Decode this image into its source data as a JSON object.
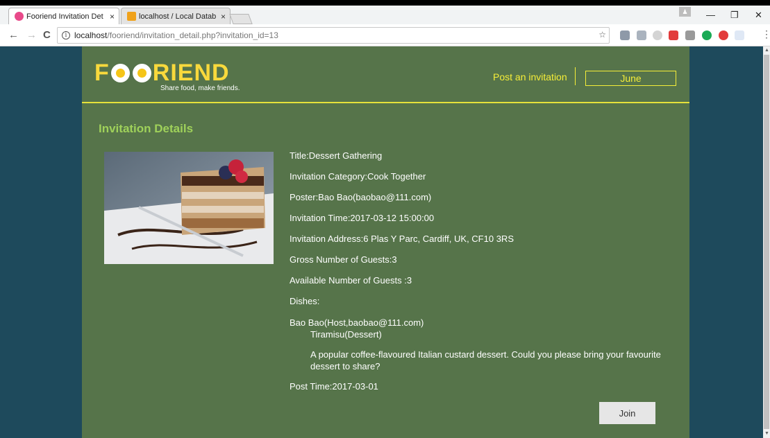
{
  "browser": {
    "tabs": [
      {
        "title": "Fooriend Invitation Det",
        "close": "×"
      },
      {
        "title": "localhost / Local Datab",
        "close": "×"
      }
    ],
    "url_host": "localhost",
    "url_path": "/fooriend/invitation_detail.php?invitation_id=13",
    "nav": {
      "back": "←",
      "forward": "→",
      "reload": "C"
    },
    "window": {
      "minimize": "—",
      "restore": "❐",
      "close": "✕"
    }
  },
  "site": {
    "logo_left": "F",
    "logo_right": "RIEND",
    "tagline": "Share food, make friends.",
    "post_invitation": "Post an invitation",
    "user_name": "June"
  },
  "section_title": "Invitation Details",
  "invitation": {
    "title": "Title:Dessert Gathering",
    "category": "Invitation Category:Cook Together",
    "poster": "Poster:Bao Bao(baobao@111.com)",
    "time": "Invitation Time:2017-03-12 15:00:00",
    "address": "Invitation Address:6 Plas Y Parc, Cardiff, UK, CF10 3RS",
    "gross_guests": "Gross Number of Guests:3",
    "available_guests": "Available Number of Guests :3",
    "dishes_label": "Dishes:",
    "dish_host": "Bao Bao(Host,baobao@111.com)",
    "dish_name": "Tiramisu(Dessert)",
    "dish_description": "A popular coffee-flavoured Italian custard dessert. Could you please bring your favourite dessert to share?",
    "post_time": "Post Time:2017-03-01"
  },
  "join_label": "Join",
  "colors": {
    "background": "#1e4a5c",
    "page": "#56744a",
    "accent_yellow": "#f6ee38",
    "title_green": "#9fd15a"
  }
}
